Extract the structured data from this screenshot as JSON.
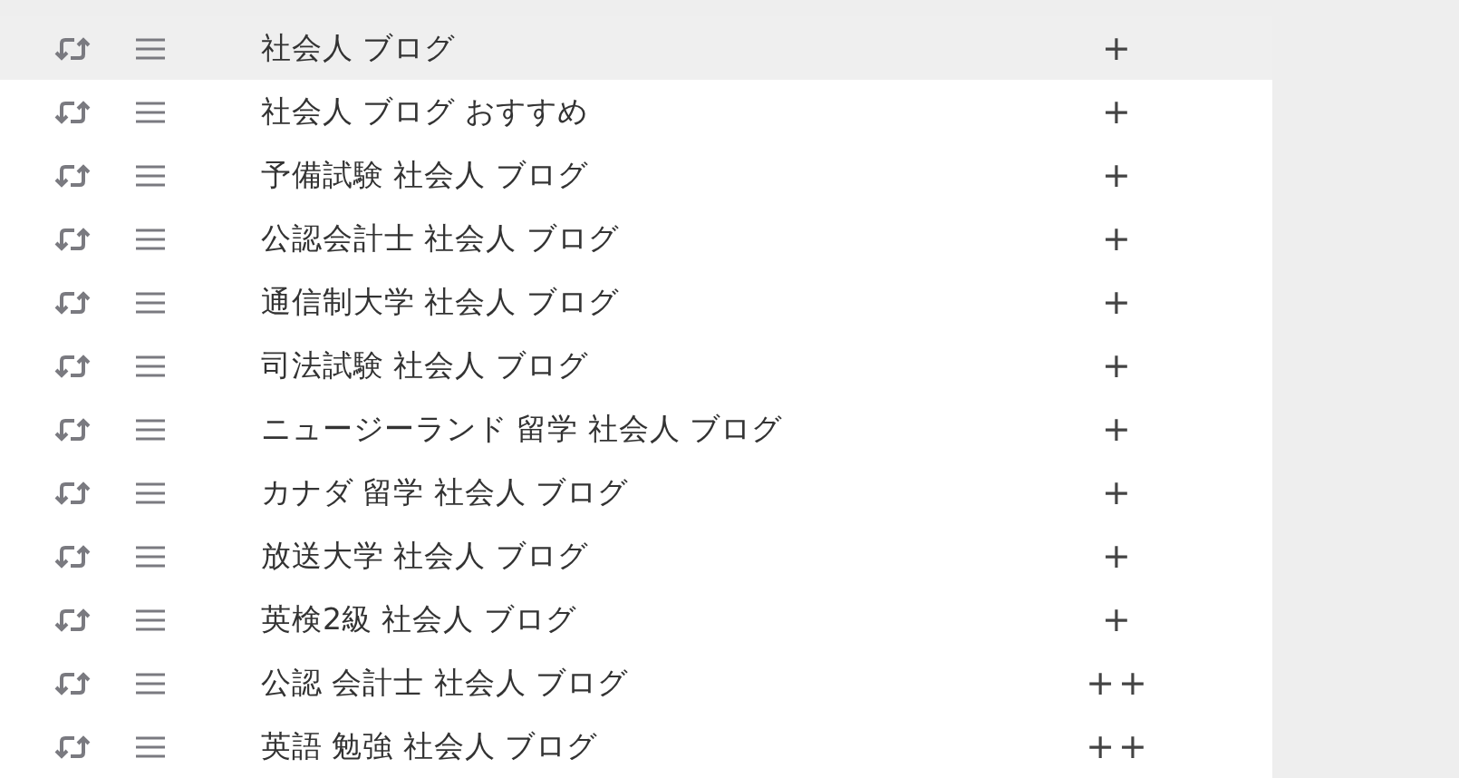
{
  "keywords": [
    {
      "text": "社会人 ブログ",
      "mark": "+",
      "selected": true
    },
    {
      "text": "社会人 ブログ おすすめ",
      "mark": "+",
      "selected": false
    },
    {
      "text": "予備試験 社会人 ブログ",
      "mark": "+",
      "selected": false
    },
    {
      "text": "公認会計士 社会人 ブログ",
      "mark": "+",
      "selected": false
    },
    {
      "text": "通信制大学 社会人 ブログ",
      "mark": "+",
      "selected": false
    },
    {
      "text": "司法試験 社会人 ブログ",
      "mark": "+",
      "selected": false
    },
    {
      "text": "ニュージーランド 留学 社会人 ブログ",
      "mark": "+",
      "selected": false
    },
    {
      "text": "カナダ 留学 社会人 ブログ",
      "mark": "+",
      "selected": false
    },
    {
      "text": "放送大学 社会人 ブログ",
      "mark": "+",
      "selected": false
    },
    {
      "text": "英検2級 社会人 ブログ",
      "mark": "+",
      "selected": false
    },
    {
      "text": "公認 会計士 社会人 ブログ",
      "mark": "++",
      "selected": false
    },
    {
      "text": "英語 勉強 社会人 ブログ",
      "mark": "++",
      "selected": false
    }
  ]
}
